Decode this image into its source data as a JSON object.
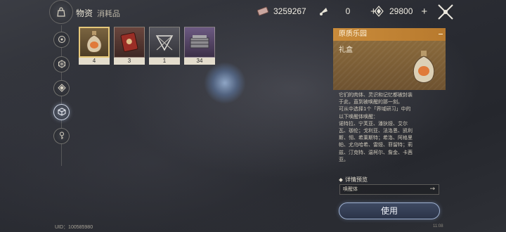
{
  "header": {
    "title": "物资",
    "subtitle": "消耗品",
    "bag_icon": "bag-icon",
    "close_icon": "close-icon"
  },
  "resources": [
    {
      "icon": "ticket-icon",
      "value": "3259267",
      "has_plus": false
    },
    {
      "icon": "horn-icon",
      "value": "0",
      "has_plus": true
    },
    {
      "icon": "crystal-icon",
      "value": "29800",
      "has_plus": true
    }
  ],
  "nav": [
    {
      "icon": "compass-icon",
      "active": false
    },
    {
      "icon": "hexagon-icon",
      "active": false
    },
    {
      "icon": "diamond-icon",
      "active": false
    },
    {
      "icon": "cube-icon",
      "active": true
    },
    {
      "icon": "key-icon",
      "active": false
    }
  ],
  "items": [
    {
      "icon": "gift-bottle-icon",
      "count": "4",
      "selected": true,
      "bg": "#6a5636"
    },
    {
      "icon": "red-book-icon",
      "count": "3",
      "selected": false,
      "bg": "#5a3a34"
    },
    {
      "icon": "prism-icon",
      "count": "1",
      "selected": false,
      "bg": "#4a4a52"
    },
    {
      "icon": "crate-icon",
      "count": "34",
      "selected": false,
      "bg": "#5c4a6e"
    }
  ],
  "detail": {
    "category": "原质乐园",
    "name": "礼盒",
    "description": "它们的肉体、灵识和记忆都被封装\n于此，直到被唤醒的那一刻。\n可从中选择1个「界域研习」中的\n以下唤醒体唤醒：\n诺特拉、宁芙亚、潘狄娅、艾尔\n瓦、珈伦；戈利亚、法洛恩、凯利\n斯、翎、希莱斯特；希洛、阿格里\n帕、尤乌哈希、雷娅、菲留特；莉\n兹、汀克特、温柯尔、詹金、卡茜\n亚。",
    "preview_label": "详情预览",
    "preview_value": "唤醒体",
    "use_label": "使用"
  },
  "footer": {
    "uid": "UID：100585980",
    "time": "11:08"
  }
}
